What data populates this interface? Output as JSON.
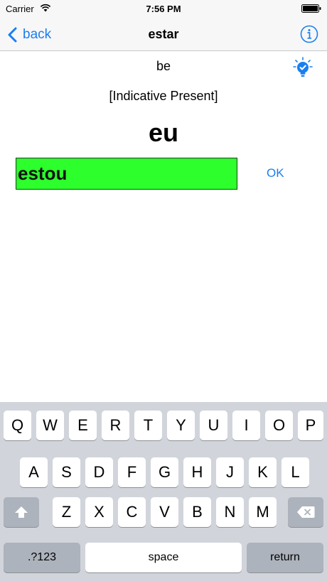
{
  "status_bar": {
    "carrier": "Carrier",
    "time": "7:56 PM"
  },
  "nav": {
    "back_label": "back",
    "title": "estar"
  },
  "exercise": {
    "translation": "be",
    "tense": "[Indicative Present]",
    "pronoun": "eu",
    "answer": "estou",
    "ok_label": "OK"
  },
  "keyboard": {
    "row1": [
      "Q",
      "W",
      "E",
      "R",
      "T",
      "Y",
      "U",
      "I",
      "O",
      "P"
    ],
    "row2": [
      "A",
      "S",
      "D",
      "F",
      "G",
      "H",
      "J",
      "K",
      "L"
    ],
    "row3": [
      "Z",
      "X",
      "C",
      "V",
      "B",
      "N",
      "M"
    ],
    "numbers_label": ".?123",
    "space_label": "space",
    "return_label": "return"
  },
  "colors": {
    "accent": "#1a7ef0",
    "answer_correct": "#2cff2c"
  }
}
